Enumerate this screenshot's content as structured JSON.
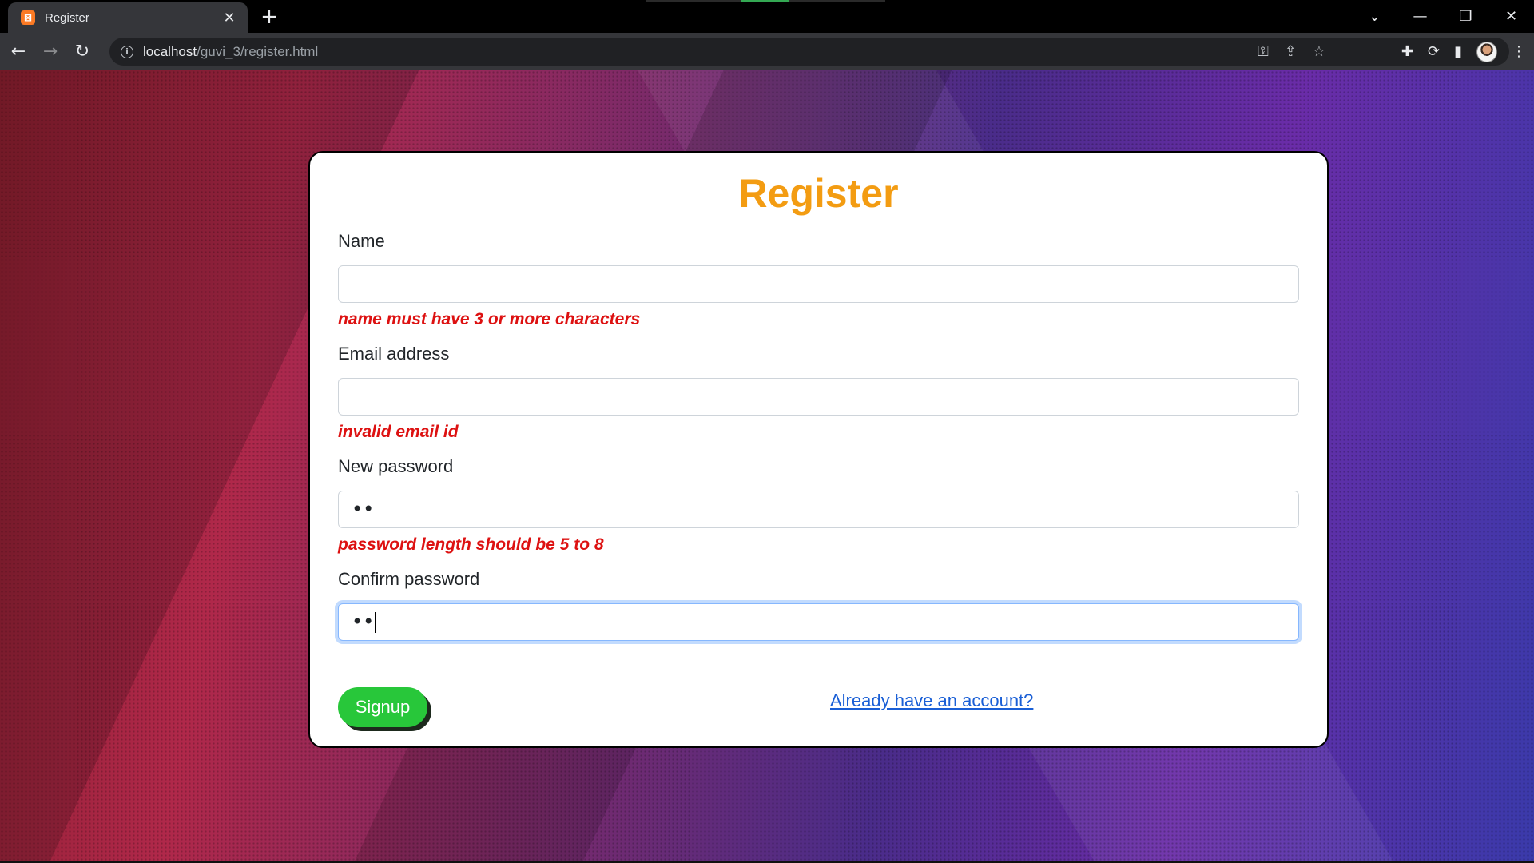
{
  "browser": {
    "tab_title": "Register",
    "favicon_letter": "⊠",
    "close_glyph": "✕",
    "new_tab_glyph": "+",
    "url_host": "localhost",
    "url_path": "/guvi_3/register.html",
    "window_controls": {
      "tabs_menu": "⌄",
      "minimize": "—",
      "restore": "❐",
      "close": "✕"
    },
    "nav": {
      "back": "←",
      "forward": "→",
      "reload": "↻"
    },
    "omni_icons": {
      "key": "⚿",
      "share": "⇪",
      "star": "☆"
    },
    "ext_icons": {
      "extensions": "✚",
      "sync": "⟳",
      "sidebar": "▮",
      "menu": "⋮"
    }
  },
  "form": {
    "title": "Register",
    "title_color": "#f39c12",
    "fields": [
      {
        "label": "Name",
        "value": "",
        "error": "name must have 3 or more characters"
      },
      {
        "label": "Email address",
        "value": "",
        "error": "invalid email id"
      },
      {
        "label": "New password",
        "value": "••",
        "error": "password length should be 5 to 8"
      },
      {
        "label": "Confirm password",
        "value": "••",
        "error": ""
      }
    ],
    "signup_label": "Signup",
    "signup_color": "#28c73a",
    "login_link": "Already have an account?",
    "error_color": "#dd1111"
  }
}
